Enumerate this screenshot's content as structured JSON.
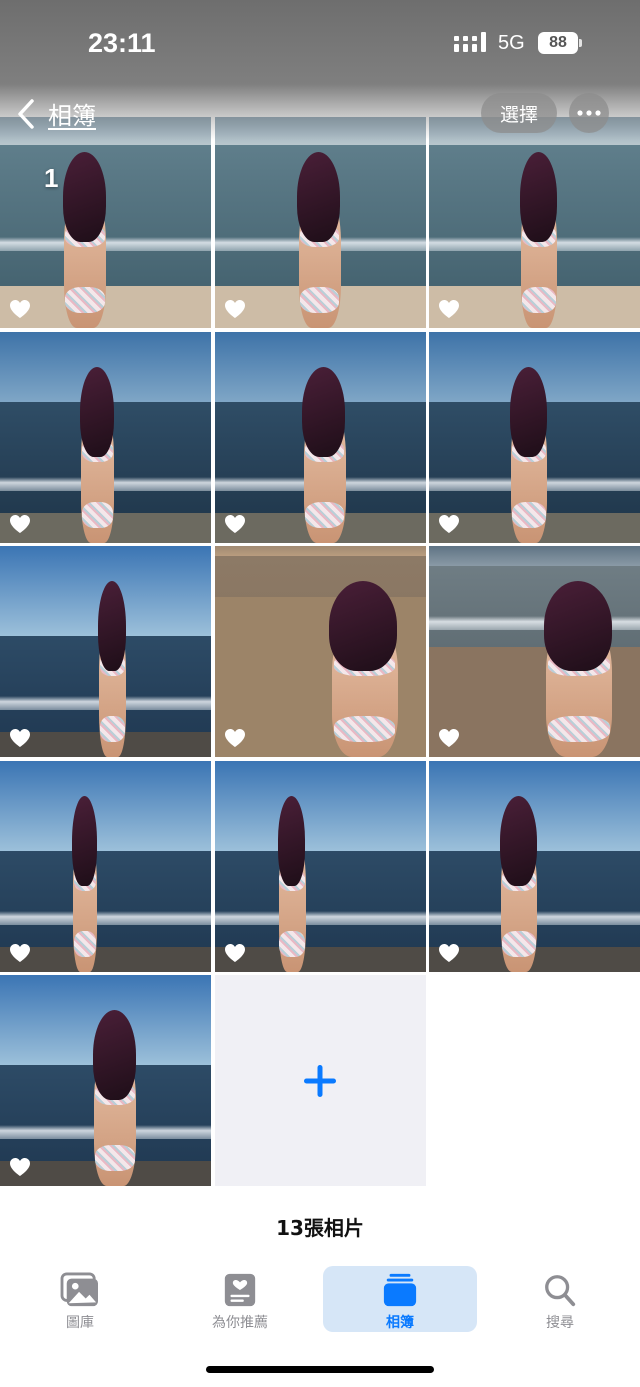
{
  "status_bar": {
    "time": "23:11",
    "network": "5G",
    "battery": "88"
  },
  "header": {
    "back_label": "相簿",
    "select_label": "選擇",
    "more_icon": "ellipsis-icon"
  },
  "grid": {
    "first_badge": "1",
    "photos": [
      {
        "scene": "beach-wave",
        "favorite_icon": "heart-icon"
      },
      {
        "scene": "beach-wave",
        "favorite_icon": "heart-icon"
      },
      {
        "scene": "beach-wave",
        "favorite_icon": "heart-icon"
      },
      {
        "scene": "beach-sea",
        "favorite_icon": "heart-icon"
      },
      {
        "scene": "beach-sea",
        "favorite_icon": "heart-icon"
      },
      {
        "scene": "beach-sea",
        "favorite_icon": "heart-icon"
      },
      {
        "scene": "beach-sky",
        "favorite_icon": "heart-icon"
      },
      {
        "scene": "beach-sand",
        "favorite_icon": "heart-icon"
      },
      {
        "scene": "beach-closeup",
        "favorite_icon": "heart-icon"
      },
      {
        "scene": "beach-sky",
        "favorite_icon": "heart-icon"
      },
      {
        "scene": "beach-sky",
        "favorite_icon": "heart-icon"
      },
      {
        "scene": "beach-sky",
        "favorite_icon": "heart-icon"
      },
      {
        "scene": "beach-sky",
        "favorite_icon": "heart-icon"
      }
    ],
    "add_icon": "plus-icon"
  },
  "footer": {
    "photo_count": "13張相片"
  },
  "tabbar": {
    "tabs": [
      {
        "label": "圖庫",
        "icon": "photo-library-icon",
        "active": false
      },
      {
        "label": "為你推薦",
        "icon": "for-you-icon",
        "active": false
      },
      {
        "label": "相簿",
        "icon": "albums-icon",
        "active": true
      },
      {
        "label": "搜尋",
        "icon": "search-icon",
        "active": false
      }
    ]
  },
  "colors": {
    "accent": "#0a7aff",
    "active_tab_bg": "#d6e6f7",
    "inactive_tab": "#8e8e93"
  }
}
